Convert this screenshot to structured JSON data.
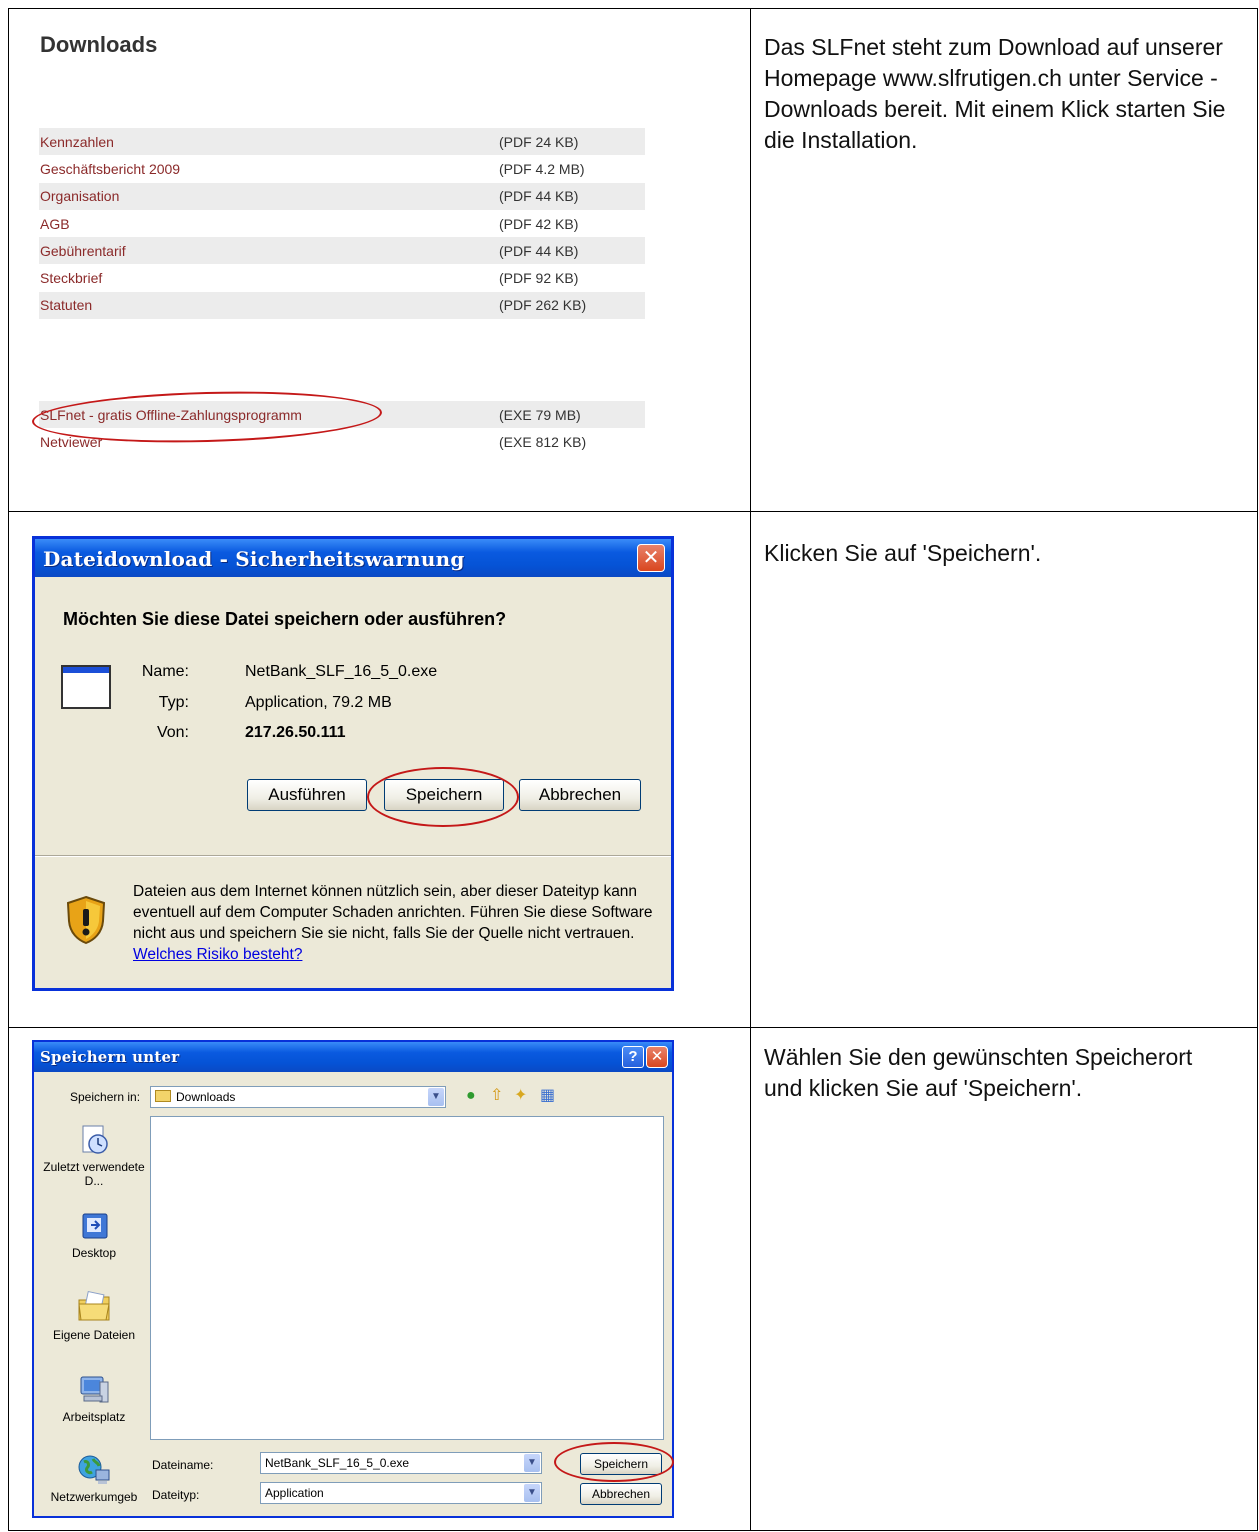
{
  "downloads": {
    "title": "Downloads",
    "items": [
      {
        "name": "Kennzahlen",
        "size": "(PDF 24 KB)"
      },
      {
        "name": "Geschäftsbericht 2009",
        "size": "(PDF 4.2 MB)"
      },
      {
        "name": "Organisation",
        "size": "(PDF 44 KB)"
      },
      {
        "name": "AGB",
        "size": "(PDF 42 KB)"
      },
      {
        "name": "Gebührentarif",
        "size": "(PDF 44 KB)"
      },
      {
        "name": "Steckbrief",
        "size": "(PDF 92 KB)"
      },
      {
        "name": "Statuten",
        "size": "(PDF 262 KB)"
      }
    ],
    "software": [
      {
        "name": "SLFnet - gratis Offline-Zahlungsprogramm",
        "size": "(EXE 79 MB)"
      },
      {
        "name": "Netviewer",
        "size": "(EXE 812 KB)"
      }
    ]
  },
  "instructions": {
    "step1": "Das SLFnet steht zum Download auf unserer Homepage www.slfrutigen.ch unter Service - Downloads bereit. Mit einem Klick starten Sie die Installation.",
    "step2": "Klicken Sie auf 'Speichern'.",
    "step3": "Wählen Sie den gewünschten Speicherort und klicken Sie auf 'Speichern'."
  },
  "download_dialog": {
    "title": "Dateidownload - Sicherheitswarnung",
    "close_label": "✕",
    "question": "Möchten Sie diese Datei speichern oder ausführen?",
    "name_label": "Name:",
    "name_value": "NetBank_SLF_16_5_0.exe",
    "type_label": "Typ:",
    "type_value": "Application, 79.2 MB",
    "from_label": "Von:",
    "from_value": "217.26.50.111",
    "run_button": "Ausführen",
    "save_button": "Speichern",
    "cancel_button": "Abbrechen",
    "warning_text": "Dateien aus dem Internet können nützlich sein, aber dieser Dateityp kann eventuell auf dem Computer Schaden anrichten. Führen Sie diese Software nicht aus und speichern Sie sie nicht, falls Sie der Quelle nicht vertrauen.",
    "warning_link": "Welches Risiko besteht?"
  },
  "save_dialog": {
    "title": "Speichern unter",
    "help_label": "?",
    "close_label": "✕",
    "save_in_label": "Speichern in:",
    "save_in_value": "Downloads",
    "places": [
      {
        "label": "Zuletzt verwendete D...",
        "icon": "recent-icon"
      },
      {
        "label": "Desktop",
        "icon": "desktop-icon"
      },
      {
        "label": "Eigene Dateien",
        "icon": "my-documents-icon"
      },
      {
        "label": "Arbeitsplatz",
        "icon": "my-computer-icon"
      },
      {
        "label": "Netzwerkumgeb",
        "icon": "network-icon"
      }
    ],
    "filename_label": "Dateiname:",
    "filename_value": "NetBank_SLF_16_5_0.exe",
    "filetype_label": "Dateityp:",
    "filetype_value": "Application",
    "save_button": "Speichern",
    "cancel_button": "Abbrechen"
  }
}
